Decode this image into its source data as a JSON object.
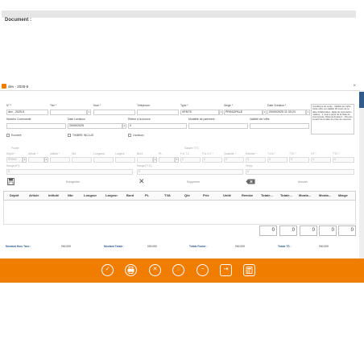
{
  "window": {
    "title": "dev - 2025-5",
    "close": "×"
  },
  "section_title": "Document :",
  "labels": {
    "no": "N° *",
    "tiers": "Tier *",
    "nom": "Nom *",
    "telephone": "Téléphone",
    "type": "Type *",
    "siege": "Siège *",
    "date_creation": "Date Création *",
    "numero_commande": "Numéro Commande",
    "date_livraison": "Date Livraison",
    "refere_source": "Refere à la source",
    "modalite_paiement": "Modalité de paiement",
    "validite_offre": "Validité de l'offre",
    "exonere": "Exonéré",
    "timbre": "TIMBRE INCLUS",
    "livraison": "Livraison",
    "footer_label": "Footer",
    "sous_ttc": "Salaire TTC",
    "depot": "Dépôt *",
    "article": "Article *",
    "intitule": "Intitulé *",
    "nbr": "Nbr",
    "longueur": "Longueur",
    "largeur": "Largeur",
    "bord": "Bord",
    "pl": "PL",
    "puht": "P.U.T.C",
    "puttc": "P.U.H.T *",
    "quantite": "Quantité *",
    "remise": "Remise *",
    "tvadoc": "T.V.A *",
    "ttc": "TTC *",
    "ht": "HT *",
    "tvd": "TVA *",
    "ttc2": "TTC *",
    "marge_ht": "Marge(HT)",
    "marge_ttc": "Marge(TTC)",
    "shipp": "Shipp"
  },
  "fields": {
    "no_value": "dev - 2025-5",
    "type_value": "VENTE",
    "siege_value": "PRINCIPALE",
    "date_creation_value": "20/09/2025 11:33:24",
    "date_livraison_value": "20/09/2025",
    "refere_value": "0",
    "depot_value": "PRINC",
    "zero": "0"
  },
  "conditions_text": "Conditions de vente : Validité de l'offre: Cette offre est valable 30 Jours de la date d'élaboration. Délai de réservation matière : 1 mois à partir de la Date de Commande. Délai de livraison : 15 jours à partir de la date de prise de mesures",
  "actions": {
    "enregistrer": "Enregistrer",
    "supprimer": "Supprimer",
    "annuler": "Annuler"
  },
  "grid_headers": [
    "Dépôt",
    "Article",
    "Intitulé",
    "Nbr",
    "Longeur",
    "Largeur",
    "Bord",
    "PL",
    "TVA",
    "Qte",
    "Prix",
    "Unité",
    "Remise",
    "Totale...",
    "Totale...",
    "Monta...",
    "Monta...",
    "Marge"
  ],
  "totals": [
    "0",
    "0",
    "0",
    "0",
    "0"
  ],
  "summary": {
    "hors_taxe_label": "Montant Hors Taxe :",
    "hors_taxe_value": "000.000",
    "totale_label": "Montant Totale :",
    "totale_value": "000.000",
    "footer_label": "Totale Footer :",
    "footer_value": "000.000",
    "ts_label": "Totale TS :",
    "ts_value": "000.000"
  },
  "toolbar_icons": [
    "check-icon",
    "print-icon",
    "cancel-icon",
    "target-icon",
    "minus-icon",
    "exit-icon",
    "calculator-icon"
  ],
  "colors": {
    "accent": "#f07d00",
    "link": "#2e5b8c"
  }
}
